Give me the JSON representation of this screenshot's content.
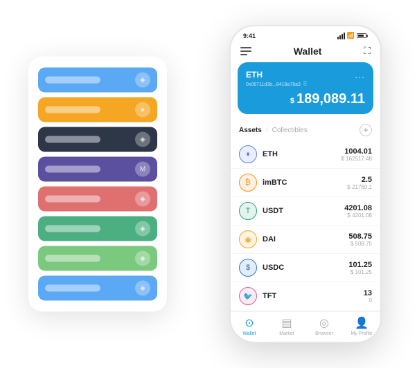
{
  "scene": {
    "back_panel": {
      "cards": [
        {
          "id": "card-blue",
          "color": "#5ba8f5",
          "icon": "◈"
        },
        {
          "id": "card-orange",
          "color": "#f5a623",
          "icon": "●"
        },
        {
          "id": "card-dark",
          "color": "#2d3748",
          "icon": "◈"
        },
        {
          "id": "card-purple",
          "color": "#5b4fa0",
          "icon": "M"
        },
        {
          "id": "card-red",
          "color": "#e07070",
          "icon": "◈"
        },
        {
          "id": "card-green",
          "color": "#4caf82",
          "icon": "◈"
        },
        {
          "id": "card-lightgreen",
          "color": "#7bc97e",
          "icon": "◈"
        },
        {
          "id": "card-lightblue",
          "color": "#5ba8f5",
          "icon": "◈"
        }
      ]
    },
    "phone": {
      "status": {
        "time": "9:41",
        "signal_label": "signal",
        "wifi_label": "wifi",
        "battery_label": "battery"
      },
      "header": {
        "menu_label": "menu",
        "title": "Wallet",
        "expand_label": "expand"
      },
      "balance_card": {
        "coin": "ETH",
        "address": "0x08711d3b...8418a78a3",
        "copy_label": "copy",
        "dots": "...",
        "currency_symbol": "$",
        "amount": "189,089.11"
      },
      "assets_section": {
        "tab_active": "Assets",
        "separator": "/",
        "tab_inactive": "Collectibles",
        "add_label": "+"
      },
      "assets": [
        {
          "symbol": "ETH",
          "icon_color": "#627eea",
          "icon_char": "♦",
          "amount": "1004.01",
          "usd": "$ 162517.48"
        },
        {
          "symbol": "imBTC",
          "icon_color": "#f7931a",
          "icon_char": "₿",
          "amount": "2.5",
          "usd": "$ 21760.1"
        },
        {
          "symbol": "USDT",
          "icon_color": "#26a17b",
          "icon_char": "T",
          "amount": "4201.08",
          "usd": "$ 4201.08"
        },
        {
          "symbol": "DAI",
          "icon_color": "#f5a623",
          "icon_char": "◉",
          "amount": "508.75",
          "usd": "$ 508.75"
        },
        {
          "symbol": "USDC",
          "icon_color": "#2775ca",
          "icon_char": "$",
          "amount": "101.25",
          "usd": "$ 101.25"
        },
        {
          "symbol": "TFT",
          "icon_color": "#e05c94",
          "icon_char": "🐦",
          "amount": "13",
          "usd": "0"
        }
      ],
      "nav": [
        {
          "id": "wallet",
          "label": "Wallet",
          "icon": "⊙",
          "active": true
        },
        {
          "id": "market",
          "label": "Market",
          "icon": "📊",
          "active": false
        },
        {
          "id": "browser",
          "label": "Browser",
          "icon": "🌐",
          "active": false
        },
        {
          "id": "profile",
          "label": "My Profile",
          "icon": "👤",
          "active": false
        }
      ]
    }
  }
}
